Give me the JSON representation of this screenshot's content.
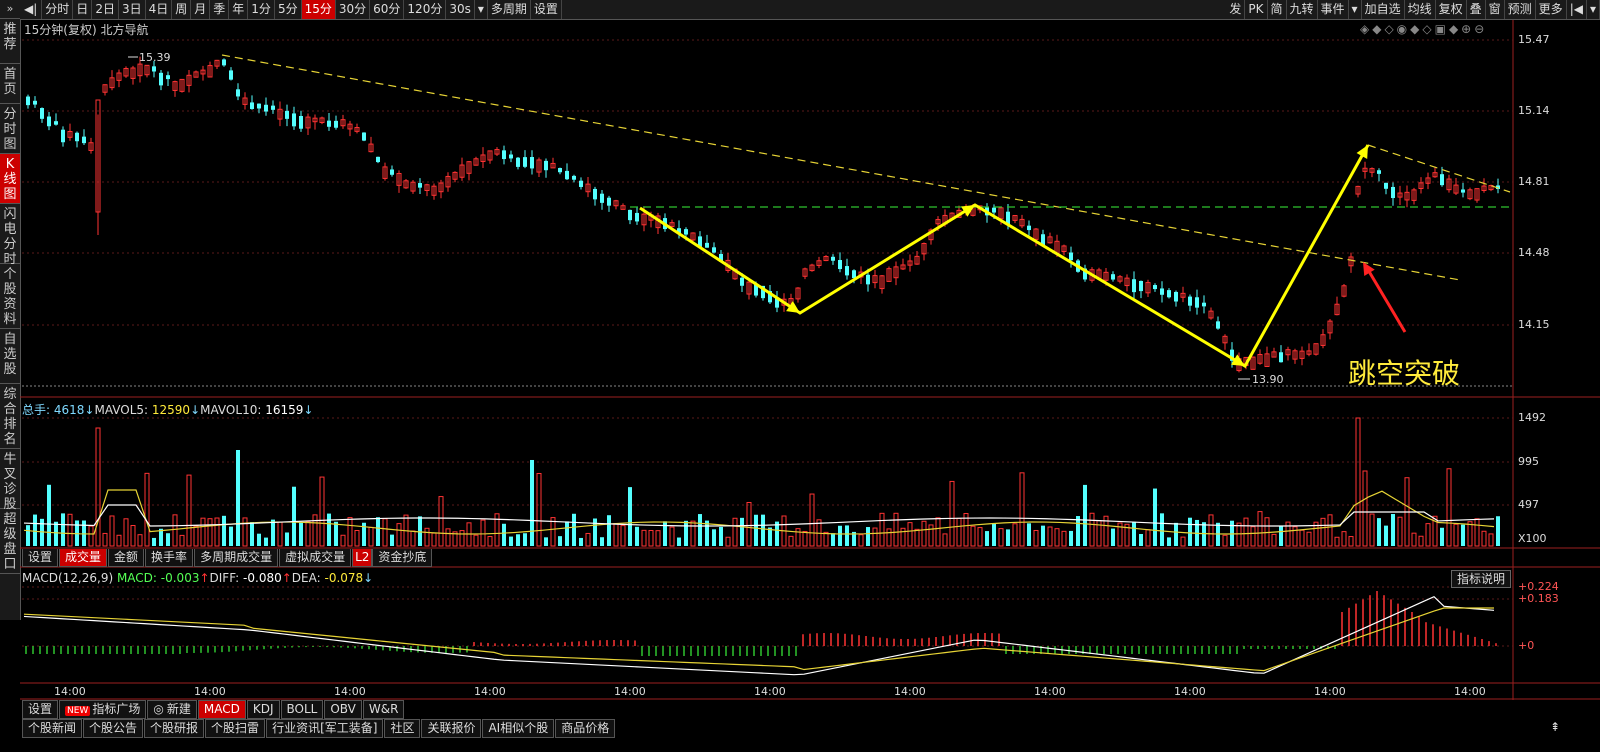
{
  "toolbar": {
    "items": [
      "分时",
      "日",
      "2日",
      "3日",
      "4日",
      "周",
      "月",
      "季",
      "年",
      "1分",
      "5分",
      "15分",
      "30分",
      "60分",
      "120分",
      "30s",
      "多周期",
      "设置"
    ],
    "active_index": 11,
    "right_items": [
      "发",
      "PK",
      "简",
      "九转",
      "事件",
      "加自选",
      "均线",
      "复权",
      "叠",
      "窗",
      "预测",
      "更多"
    ]
  },
  "left_nav": [
    "推荐",
    "首页",
    "分时图",
    "K线图",
    "闪电分时",
    "个股资料",
    "自选股",
    "综合排名",
    "牛叉诊股",
    "超级盘口"
  ],
  "left_nav_active": 3,
  "chart_header": {
    "title": "15分钟(复权)  北方导航"
  },
  "price_axis": [
    "15.47",
    "15.14",
    "14.81",
    "14.48",
    "14.15"
  ],
  "hi_label": "15.39",
  "lo_label": "13.90",
  "annotation": "跳空突破",
  "volume_header": {
    "label1": "总手: ",
    "value1": "4618",
    "label2": "MAVOL5: ",
    "value2": "12590",
    "label3": "MAVOL10: ",
    "value3": "16159"
  },
  "volume_axis": [
    "1492",
    "995",
    "497",
    "X100"
  ],
  "volume_tabs": [
    "设置",
    "成交量",
    "金额",
    "换手率",
    "多周期成交量",
    "虚拟成交量",
    "L2",
    "资金抄底"
  ],
  "volume_tab_active": 1,
  "macd_header": {
    "label0": "MACD(12,26,9) ",
    "label1": "MACD: ",
    "value1": "-0.003",
    "label2": "DIFF: ",
    "value2": "-0.080",
    "label3": "DEA: ",
    "value3": "-0.078"
  },
  "macd_axis": [
    "+0.224",
    "+0.183",
    "+0"
  ],
  "help_button": "指标说明",
  "time_labels": [
    "14:00",
    "14:00",
    "14:00",
    "14:00",
    "14:00",
    "14:00",
    "14:00",
    "14:00",
    "14:00",
    "14:00",
    "14:00"
  ],
  "bottom_tabs1": [
    "设置",
    "指标广场",
    "新建",
    "MACD",
    "KDJ",
    "BOLL",
    "OBV",
    "W&R"
  ],
  "bottom_tabs1_active": 3,
  "new_badge": "NEW",
  "bottom_tabs2": [
    "个股新闻",
    "个股公告",
    "个股研报",
    "个股扫雷",
    "行业资讯[军工装备]",
    "社区",
    "关联报价",
    "AI相似个股",
    "商品价格"
  ],
  "colors": {
    "up": "#ff3333",
    "down": "#54ffff",
    "accent": "#cc0000",
    "annotation": "#ffeb3b"
  }
}
